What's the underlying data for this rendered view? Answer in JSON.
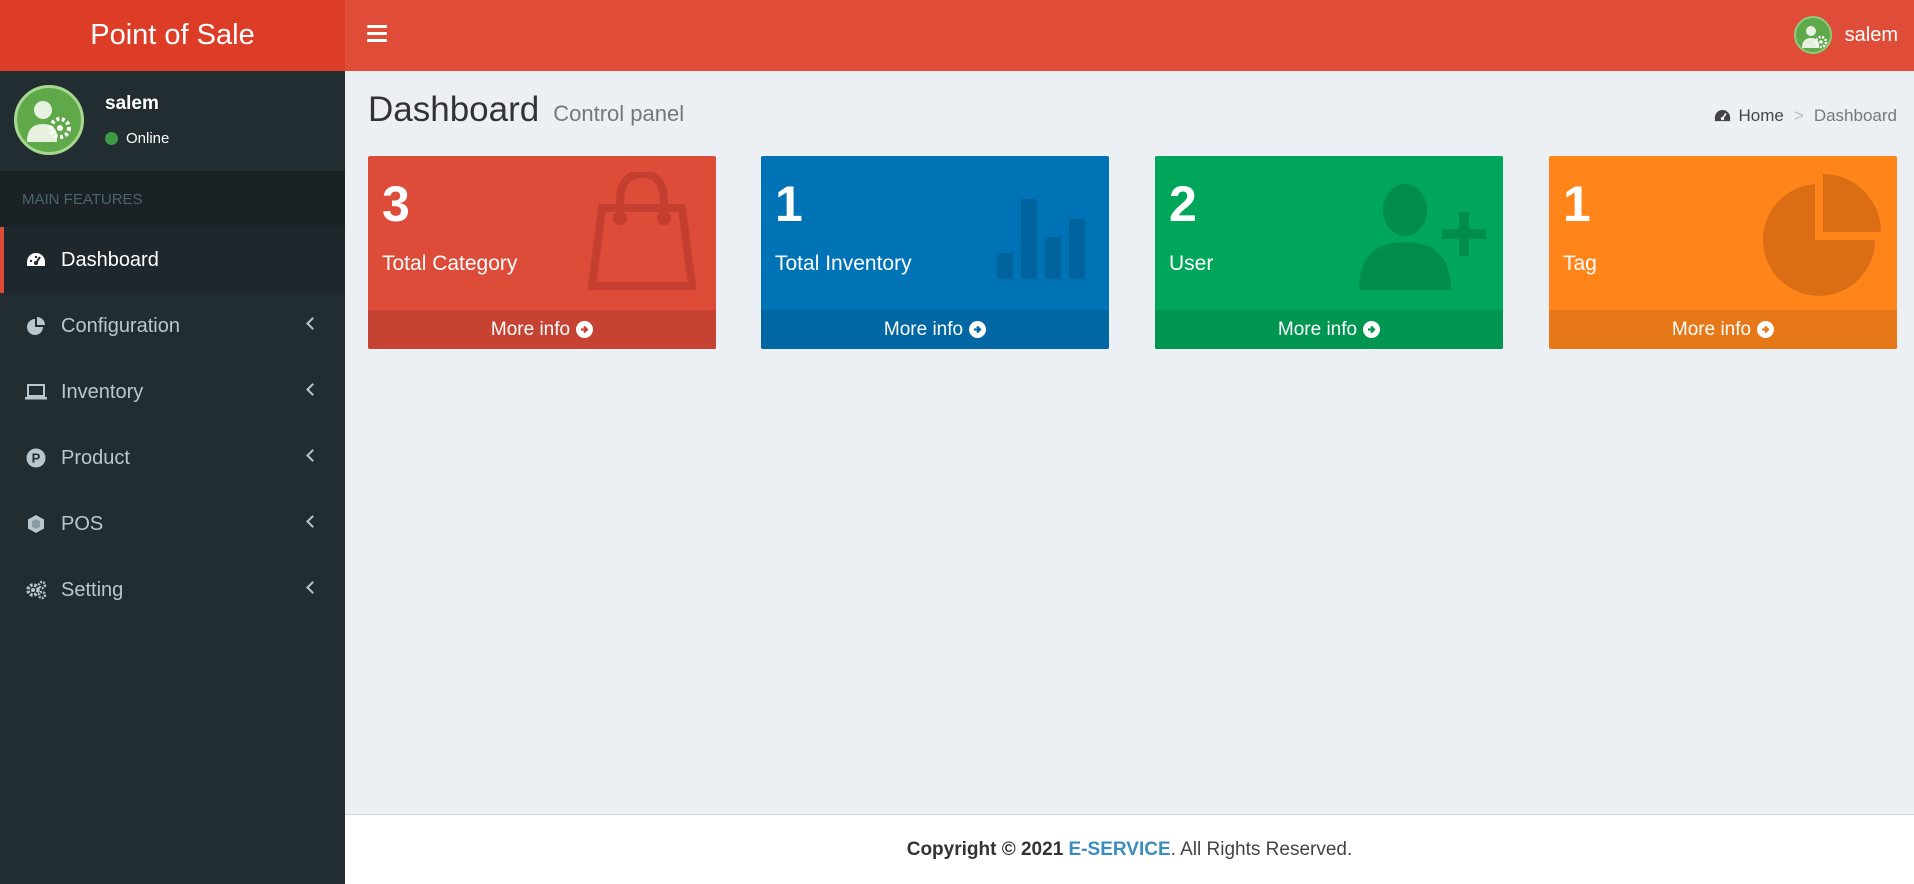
{
  "app": {
    "logo": "Point of Sale"
  },
  "topbar": {
    "username": "salem"
  },
  "sidebar": {
    "user": {
      "name": "salem",
      "status": "Online"
    },
    "section_header": "MAIN FEATURES",
    "items": [
      {
        "label": "Dashboard",
        "icon": "dashboard-icon"
      },
      {
        "label": "Configuration",
        "icon": "pie-chart-icon"
      },
      {
        "label": "Inventory",
        "icon": "laptop-icon"
      },
      {
        "label": "Product",
        "icon": "product-p-icon"
      },
      {
        "label": "POS",
        "icon": "cube-icon"
      },
      {
        "label": "Setting",
        "icon": "gears-icon"
      }
    ]
  },
  "content": {
    "title": "Dashboard",
    "subtitle": "Control panel",
    "breadcrumb": {
      "home": "Home",
      "current": "Dashboard",
      "separator": ">"
    }
  },
  "boxes": [
    {
      "value": "3",
      "label": "Total Category",
      "more": "More info",
      "color": "#dd4b39",
      "footer_color": "#c64333",
      "icon": "shopping-bag-icon"
    },
    {
      "value": "1",
      "label": "Total Inventory",
      "more": "More info",
      "color": "#0073b7",
      "footer_color": "#0067a4",
      "icon": "bar-chart-icon"
    },
    {
      "value": "2",
      "label": "User",
      "more": "More info",
      "color": "#00a65a",
      "footer_color": "#009551",
      "icon": "user-plus-icon"
    },
    {
      "value": "1",
      "label": "Tag",
      "more": "More info",
      "color": "#ff851b",
      "footer_color": "#e67818",
      "icon": "pie-chart-icon"
    }
  ],
  "footer": {
    "prefix": "Copyright © 2021 ",
    "company": "E-SERVICE",
    "suffix": ". All Rights Reserved."
  }
}
